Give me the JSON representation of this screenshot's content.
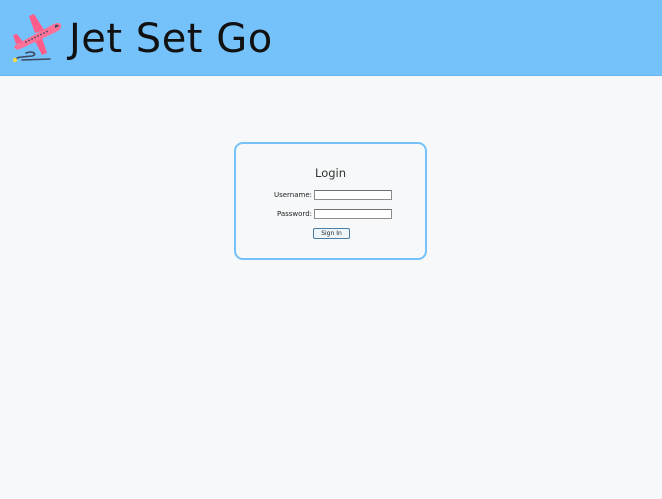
{
  "header": {
    "title": "Jet Set Go",
    "logo_icon": "airplane-icon",
    "background_color": "#75c2fa"
  },
  "login": {
    "title": "Login",
    "username_label": "Username:",
    "username_value": "",
    "password_label": "Password:",
    "password_value": "",
    "signin_label": "Sign In",
    "border_color": "#75c2fa"
  }
}
